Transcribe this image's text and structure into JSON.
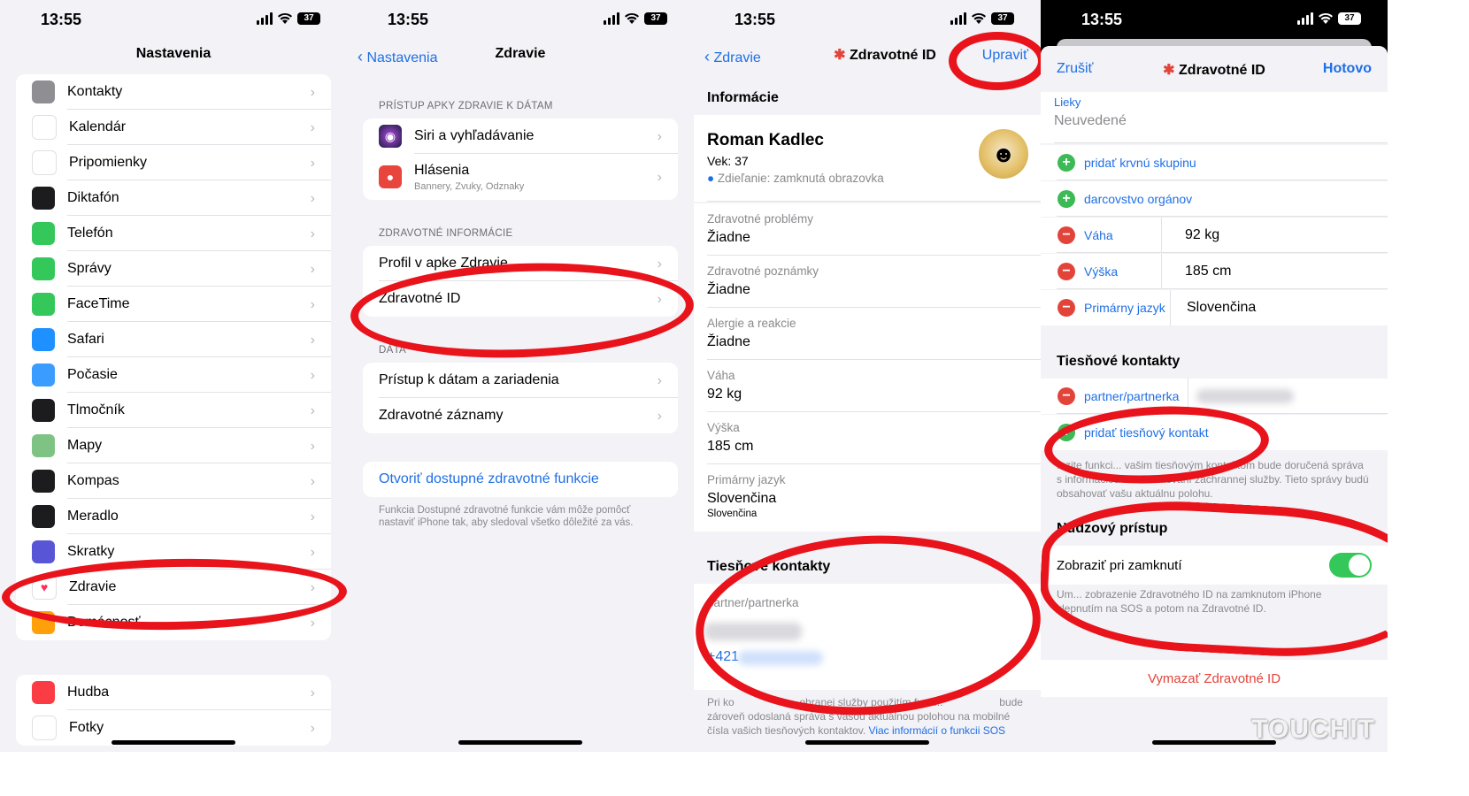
{
  "status": {
    "time": "13:55",
    "battery": "37"
  },
  "panel1": {
    "title": "Nastavenia",
    "items": [
      {
        "label": "Kontakty",
        "icon": "contacts-icon",
        "color": "#8e8e93"
      },
      {
        "label": "Kalendár",
        "icon": "calendar-icon",
        "color": "#ffffff"
      },
      {
        "label": "Pripomienky",
        "icon": "reminders-icon",
        "color": "#ffffff"
      },
      {
        "label": "Diktafón",
        "icon": "voice-memos-icon",
        "color": "#1c1c1e"
      },
      {
        "label": "Telefón",
        "icon": "phone-icon",
        "color": "#34c759"
      },
      {
        "label": "Správy",
        "icon": "messages-icon",
        "color": "#34c759"
      },
      {
        "label": "FaceTime",
        "icon": "facetime-icon",
        "color": "#34c759"
      },
      {
        "label": "Safari",
        "icon": "safari-icon",
        "color": "#1e90ff"
      },
      {
        "label": "Počasie",
        "icon": "weather-icon",
        "color": "#3b9cff"
      },
      {
        "label": "Tlmočník",
        "icon": "translate-icon",
        "color": "#1c1c1e"
      },
      {
        "label": "Mapy",
        "icon": "maps-icon",
        "color": "#7ec384"
      },
      {
        "label": "Kompas",
        "icon": "compass-icon",
        "color": "#1c1c1e"
      },
      {
        "label": "Meradlo",
        "icon": "measure-icon",
        "color": "#1c1c1e"
      },
      {
        "label": "Skratky",
        "icon": "shortcuts-icon",
        "color": "#5856d6"
      },
      {
        "label": "Zdravie",
        "icon": "heart-icon",
        "color": "#ffffff"
      },
      {
        "label": "Domácnosť",
        "icon": "home-icon",
        "color": "#ff9f0a"
      }
    ],
    "items2": [
      {
        "label": "Hudba",
        "icon": "music-icon",
        "color": "#fc3c44"
      },
      {
        "label": "Fotky",
        "icon": "photos-icon",
        "color": "#ffffff"
      }
    ]
  },
  "panel2": {
    "back": "Nastavenia",
    "title": "Zdravie",
    "section1": "PRÍSTUP APKY ZDRAVIE K DÁTAM",
    "siri": "Siri a vyhľadávanie",
    "notif": "Hlásenia",
    "notif_sub": "Bannery, Zvuky, Odznaky",
    "section2": "ZDRAVOTNÉ INFORMÁCIE",
    "profile": "Profil v apke Zdravie",
    "medical_id": "Zdravotné ID",
    "section3": "DÁTA",
    "access": "Prístup k dátam a zariadenia",
    "records": "Zdravotné záznamy",
    "open_features": "Otvoriť dostupné zdravotné funkcie",
    "footer": "Funkcia Dostupné zdravotné funkcie vám môže pomôcť nastaviť iPhone tak, aby sledoval všetko dôležité za vás."
  },
  "panel3": {
    "back": "Zdravie",
    "title": "Zdravotné ID",
    "edit": "Upraviť",
    "info_header": "Informácie",
    "name": "Roman Kadlec",
    "age": "Vek: 37",
    "sharing": "Zdieľanie: zamknutá obrazovka",
    "fields": [
      {
        "label": "Zdravotné problémy",
        "value": "Žiadne"
      },
      {
        "label": "Zdravotné poznámky",
        "value": "Žiadne"
      },
      {
        "label": "Alergie a reakcie",
        "value": "Žiadne"
      },
      {
        "label": "Váha",
        "value": "92 kg"
      },
      {
        "label": "Výška",
        "value": "185 cm"
      }
    ],
    "lang_label": "Primárny jazyk",
    "lang_value": "Slovenčina",
    "lang_sub": "Slovenčina",
    "emergency_header": "Tiesňové kontakty",
    "contact_rel": "partner/partnerka",
    "contact_phone": "+421",
    "footer_a": "Pri ko",
    "footer_b": "...ohranej služby použitím funk...",
    "footer_c": "bude",
    "footer2": "zároveň odoslaná správa s vašou aktuálnou polohou na mobilné čísla vašich tiesňových kontaktov.",
    "footer_link": "Viac informácií o funkcii SOS"
  },
  "panel4": {
    "cancel": "Zrušiť",
    "title": "Zdravotné ID",
    "done": "Hotovo",
    "meds_label": "Lieky",
    "meds_value": "Neuvedené",
    "add_blood": "pridať krvnú skupinu",
    "add_donor": "darcovstvo orgánov",
    "weight_label": "Váha",
    "weight_value": "92 kg",
    "height_label": "Výška",
    "height_value": "185 cm",
    "lang_label": "Primárny jazyk",
    "lang_value": "Slovenčina",
    "emergency_header": "Tiesňové kontakty",
    "contact_rel": "partner/partnerka",
    "add_contact": "pridať tiesňový kontakt",
    "em_footer": "...zite funkci... vašim tiesňovým kontaktom bude doručená správa s informáciou o kontaktovaní záchrannej služby. Tieto správy budú obsahovať vašu aktuálnu polohu.",
    "access_header": "Núdzový prístup",
    "show_locked": "Zobraziť pri zamknutí",
    "access_footer": "Um... zobrazenie Zdravotného ID na zamknutom iPhone klepnutím na SOS a potom na Zdravotné ID.",
    "delete": "Vymazať Zdravotné ID",
    "watermark": "TOUCHIT"
  }
}
